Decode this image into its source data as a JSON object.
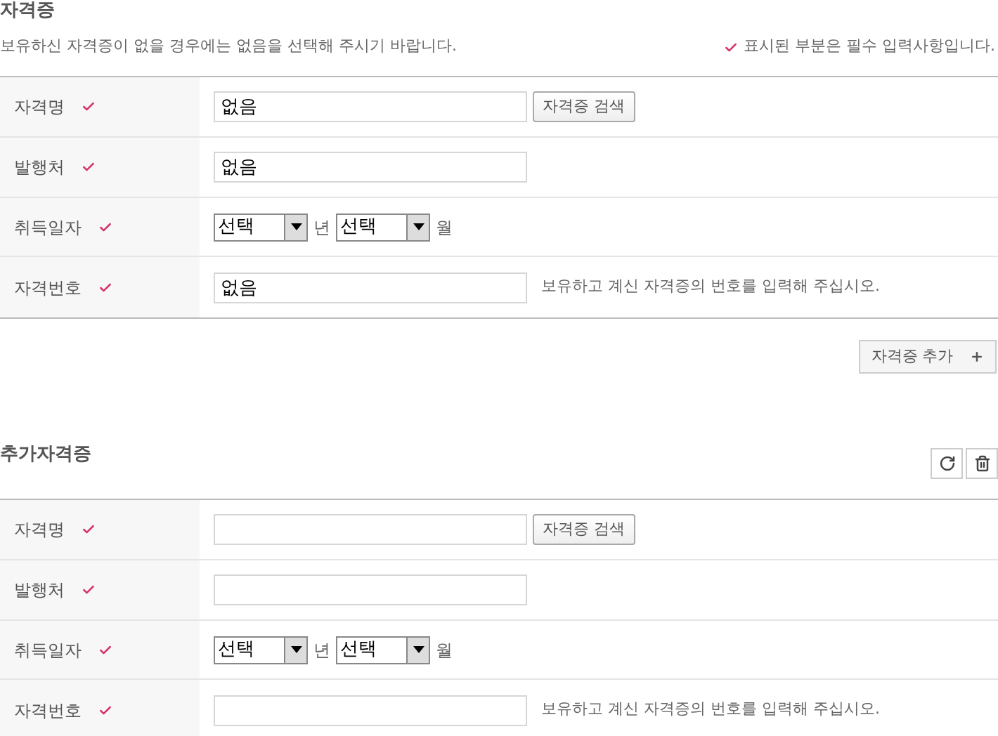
{
  "sections": [
    {
      "title": "자격증",
      "description": "보유하신 자격증이 없을 경우에는 없음을 선택해 주시기 바랍니다.",
      "required_note": "표시된 부분은 필수 입력사항입니다.",
      "rows": [
        {
          "kind": "text",
          "label": "자격명",
          "required": true,
          "value": "없음",
          "button": "자격증 검색"
        },
        {
          "kind": "text",
          "label": "발행처",
          "required": true,
          "value": "없음"
        },
        {
          "kind": "date",
          "label": "취득일자",
          "required": true,
          "selects": [
            {
              "value": "선택",
              "unit": "년"
            },
            {
              "value": "선택",
              "unit": "월"
            }
          ]
        },
        {
          "kind": "text",
          "label": "자격번호",
          "required": true,
          "value": "없음",
          "hint": "보유하고 계신 자격증의 번호를 입력해 주십시오."
        }
      ],
      "add_button": "자격증 추가"
    },
    {
      "title": "추가자격증",
      "actions": [
        {
          "kind": "refresh"
        },
        {
          "kind": "delete"
        }
      ],
      "rows": [
        {
          "kind": "text",
          "label": "자격명",
          "required": true,
          "button": "자격증 검색"
        },
        {
          "kind": "text",
          "label": "발행처",
          "required": true
        },
        {
          "kind": "date",
          "label": "취득일자",
          "required": true,
          "selects": [
            {
              "value": "선택",
              "unit": "년"
            },
            {
              "value": "선택",
              "unit": "월"
            }
          ]
        },
        {
          "kind": "text",
          "label": "자격번호",
          "required": true,
          "hint": "보유하고 계신 자격증의 번호를 입력해 주십시오."
        }
      ]
    }
  ]
}
